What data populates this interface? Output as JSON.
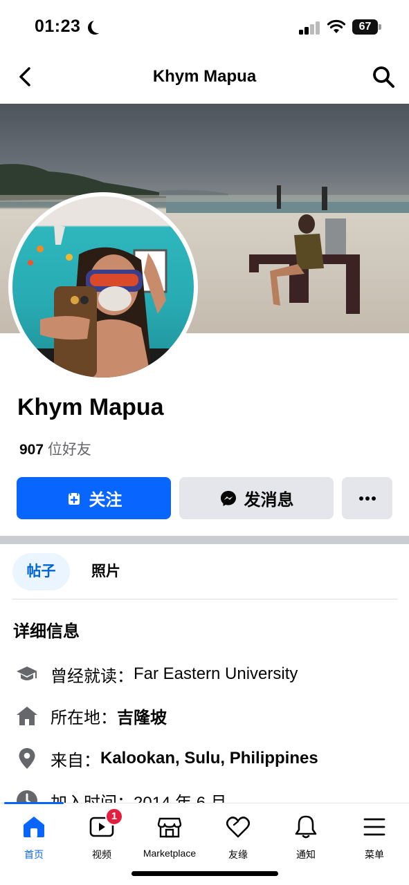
{
  "status_bar": {
    "time": "01:23",
    "battery": "67"
  },
  "header": {
    "title": "Khym Mapua"
  },
  "profile": {
    "name": "Khym Mapua",
    "friends_count": "907",
    "friends_label": " 位好友"
  },
  "actions": {
    "follow": "关注",
    "message": "发消息"
  },
  "tabs": [
    {
      "label": "帖子",
      "active": true
    },
    {
      "label": "照片",
      "active": false
    }
  ],
  "details": {
    "title": "详细信息",
    "items": [
      {
        "icon": "graduation-cap-icon",
        "label": "曾经就读：",
        "value": "Far Eastern University",
        "bold": false
      },
      {
        "icon": "home-icon",
        "label": "所在地：",
        "value": "吉隆坡",
        "bold": true
      },
      {
        "icon": "location-pin-icon",
        "label": "来自：",
        "value": "Kalookan, Sulu, Philippines",
        "bold": true
      },
      {
        "icon": "clock-icon",
        "label": "加入时间：",
        "value": "2014 年 6 月",
        "bold": false
      }
    ]
  },
  "bottom_nav": [
    {
      "label": "首页",
      "icon": "home-icon",
      "active": true
    },
    {
      "label": "视频",
      "icon": "video-icon",
      "badge": "1"
    },
    {
      "label": "Marketplace",
      "icon": "marketplace-icon"
    },
    {
      "label": "友缘",
      "icon": "dating-heart-icon"
    },
    {
      "label": "通知",
      "icon": "bell-icon"
    },
    {
      "label": "菜单",
      "icon": "menu-icon"
    }
  ],
  "colors": {
    "accent": "#0866ff",
    "badge": "#e41e3f",
    "tab_active_bg": "#ebf5ff"
  }
}
